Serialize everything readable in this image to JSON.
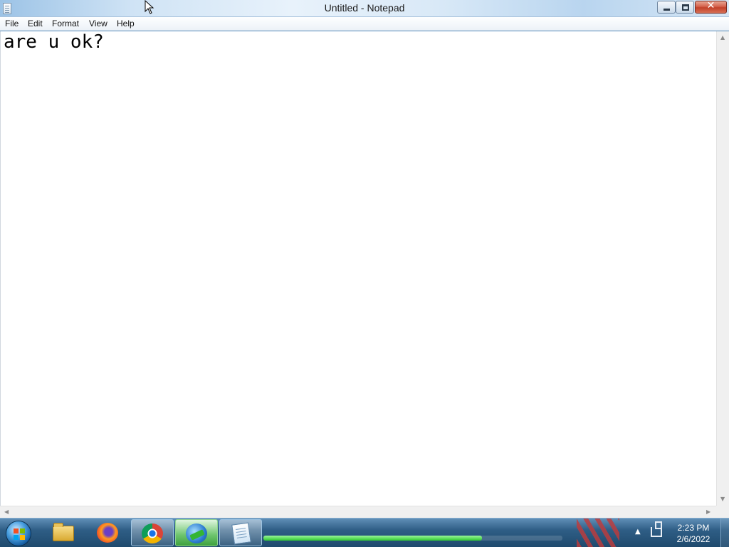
{
  "window": {
    "title": "Untitled - Notepad",
    "close_glyph": "✕"
  },
  "menu": {
    "items": [
      "File",
      "Edit",
      "Format",
      "View",
      "Help"
    ]
  },
  "editor": {
    "content": "are u ok?"
  },
  "taskbar": {
    "pinned": [
      {
        "name": "windows-explorer",
        "icon": "folder-icon"
      },
      {
        "name": "firefox",
        "icon": "firefox-icon"
      },
      {
        "name": "chrome",
        "icon": "chrome-icon"
      },
      {
        "name": "internet-download-manager",
        "icon": "idm-icon"
      },
      {
        "name": "notepad",
        "icon": "notepad-icon"
      }
    ],
    "download_progress": 0.73,
    "clock": {
      "time": "2:23 PM",
      "date": "2/6/2022"
    }
  }
}
